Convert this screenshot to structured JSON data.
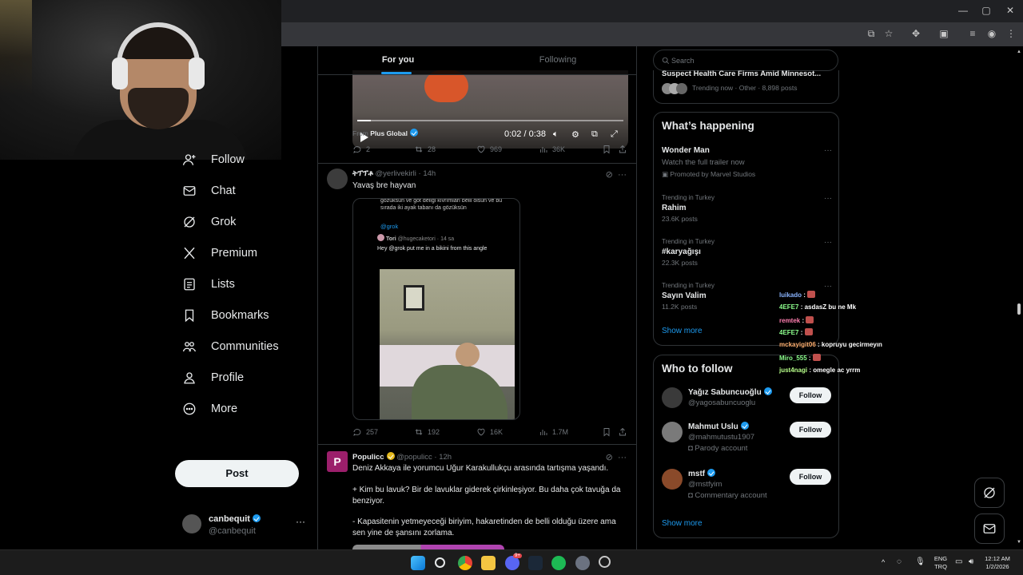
{
  "feed": {
    "tabs": [
      {
        "label": "For you"
      },
      {
        "label": "Following"
      }
    ],
    "tweet1": {
      "video_time": "0:02 / 0:38",
      "video_progress_fraction": 0.05,
      "from_prefix": "From",
      "from_source": "Plus Global",
      "replies": "2",
      "reposts": "28",
      "likes": "969",
      "views": "36K"
    },
    "tweet2": {
      "display_name": "ትፕፕቶ",
      "handle": "@yerlivekirli",
      "time": "14h",
      "text": "Yavaş bre hayvan",
      "media_text_top": "gözüksün ve göt deliği kıvrımları belli olsun ve bu sırada iki ayak tabanı da gözüksün",
      "media_mention": "@grok",
      "quote_name": "Tori",
      "quote_handle": "@hugecaketori",
      "quote_time": "14 sa",
      "quote_text": "Hey @grok put me in a bikini from this angle",
      "replies": "257",
      "reposts": "192",
      "likes": "16K",
      "views": "1.7M"
    },
    "tweet3": {
      "avatar_letter": "P",
      "display_name": "Populicc",
      "handle": "@populicc",
      "time": "12h",
      "line1": "Deniz Akkaya ile yorumcu Uğur Karakullukçu arasında tartışma yaşandı.",
      "line2": "+ Kim bu lavuk? Bir de lavuklar giderek çirkinleşiyor. Bu daha çok tavuğa da benziyor.",
      "line3": "- Kapasitenin yetmeyeceği biriyim, hakaretinden de belli olduğu üzere ama sen yine de şansını zorlama."
    }
  },
  "nav": {
    "items": [
      {
        "label": "Follow",
        "icon": "follow-icon"
      },
      {
        "label": "Chat",
        "icon": "mail-icon"
      },
      {
        "label": "Grok",
        "icon": "grok-icon"
      },
      {
        "label": "Premium",
        "icon": "x-logo-icon"
      },
      {
        "label": "Lists",
        "icon": "lists-icon"
      },
      {
        "label": "Bookmarks",
        "icon": "bookmark-icon"
      },
      {
        "label": "Communities",
        "icon": "communities-icon"
      },
      {
        "label": "Profile",
        "icon": "profile-icon"
      },
      {
        "label": "More",
        "icon": "more-icon"
      }
    ],
    "post_label": "Post",
    "account_name": "canbequit",
    "account_handle": "@canbequit",
    "account_more": "···"
  },
  "sidebar": {
    "search_placeholder": "Search",
    "top_trend_title": "Suspect Health Care Firms Amid Minnesot...",
    "top_trend_meta": "Trending now · Other · 8,898 posts",
    "happening_title": "What’s happening",
    "promo_name": "Wonder Man",
    "promo_desc": "Watch the full trailer now",
    "promo_by": "Promoted by Marvel Studios",
    "trends": [
      {
        "context": "Trending in Turkey",
        "name": "Rahim",
        "count": "23.6K posts"
      },
      {
        "context": "Trending in Turkey",
        "name": "#karyağışı",
        "count": "22.3K posts"
      },
      {
        "context": "Trending in Turkey",
        "name": "Sayın Valim",
        "count": "11.2K posts"
      }
    ],
    "show_more": "Show more",
    "wtf_title": "Who to follow",
    "wtf": [
      {
        "name": "Yağız Sabuncuoğlu",
        "handle": "@yagosabuncuoglu",
        "note": "",
        "button": "Follow"
      },
      {
        "name": "Mahmut Uslu",
        "handle": "@mahmutustu1907",
        "note": "Parody account",
        "button": "Follow"
      },
      {
        "name": "mstf",
        "handle": "@mstfyim",
        "note": "Commentary account",
        "button": "Follow"
      }
    ],
    "wtf_show_more": "Show more"
  },
  "chat": [
    {
      "user": "luikado",
      "msg": "",
      "color": "#8ab4ff"
    },
    {
      "user": "4EFE7",
      "msg": "asdasZ bu ne Mk",
      "color": "#8dff8d"
    },
    {
      "user": "remtek",
      "msg": "",
      "color": "#ff7fb0"
    },
    {
      "user": "4EFE7",
      "msg": "",
      "color": "#8dff8d"
    },
    {
      "user": "mckayigit06",
      "msg": "kopruyu gecirmeyın",
      "color": "#ffb070"
    },
    {
      "user": "Miro_555",
      "msg": "",
      "color": "#8dff8d"
    },
    {
      "user": "just4nagi",
      "msg": "omegle ac yrrm",
      "color": "#b8ff8a"
    }
  ],
  "taskbar": {
    "lang_top": "ENG",
    "lang_bottom": "TRQ",
    "time": "12:12 AM",
    "date": "1/2/2026",
    "discord_badge": "9+"
  },
  "colors": {
    "accent": "#1d9bf0",
    "background": "#000000",
    "text": "#e7e9ea",
    "muted": "#71767b",
    "border": "#2f3336"
  }
}
